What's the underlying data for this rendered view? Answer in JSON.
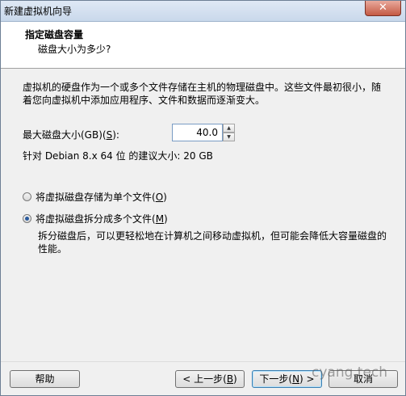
{
  "window": {
    "title": "新建虚拟机向导",
    "close_symbol": "✕"
  },
  "header": {
    "title": "指定磁盘容量",
    "subtitle": "磁盘大小为多少?"
  },
  "description": "虚拟机的硬盘作为一个或多个文件存储在主机的物理磁盘中。这些文件最初很小，随着您向虚拟机中添加应用程序、文件和数据而逐渐变大。",
  "disk_size": {
    "label_prefix": "最大磁盘大小(GB)(",
    "label_key": "S",
    "label_suffix": "):",
    "value": "40.0"
  },
  "recommend": "针对 Debian 8.x 64 位 的建议大小: 20 GB",
  "options": [
    {
      "label_prefix": "将虚拟磁盘存储为单个文件(",
      "key": "O",
      "label_suffix": ")",
      "checked": false
    },
    {
      "label_prefix": "将虚拟磁盘拆分成多个文件(",
      "key": "M",
      "label_suffix": ")",
      "checked": true
    }
  ],
  "split_description": "拆分磁盘后，可以更轻松地在计算机之间移动虚拟机，但可能会降低大容量磁盘的性能。",
  "buttons": {
    "help": "帮助",
    "back_prefix": "< 上一步(",
    "back_key": "B",
    "back_suffix": ")",
    "next_prefix": "下一步(",
    "next_key": "N",
    "next_suffix": ") >",
    "cancel": "取消"
  },
  "watermark": "cyang.tech"
}
